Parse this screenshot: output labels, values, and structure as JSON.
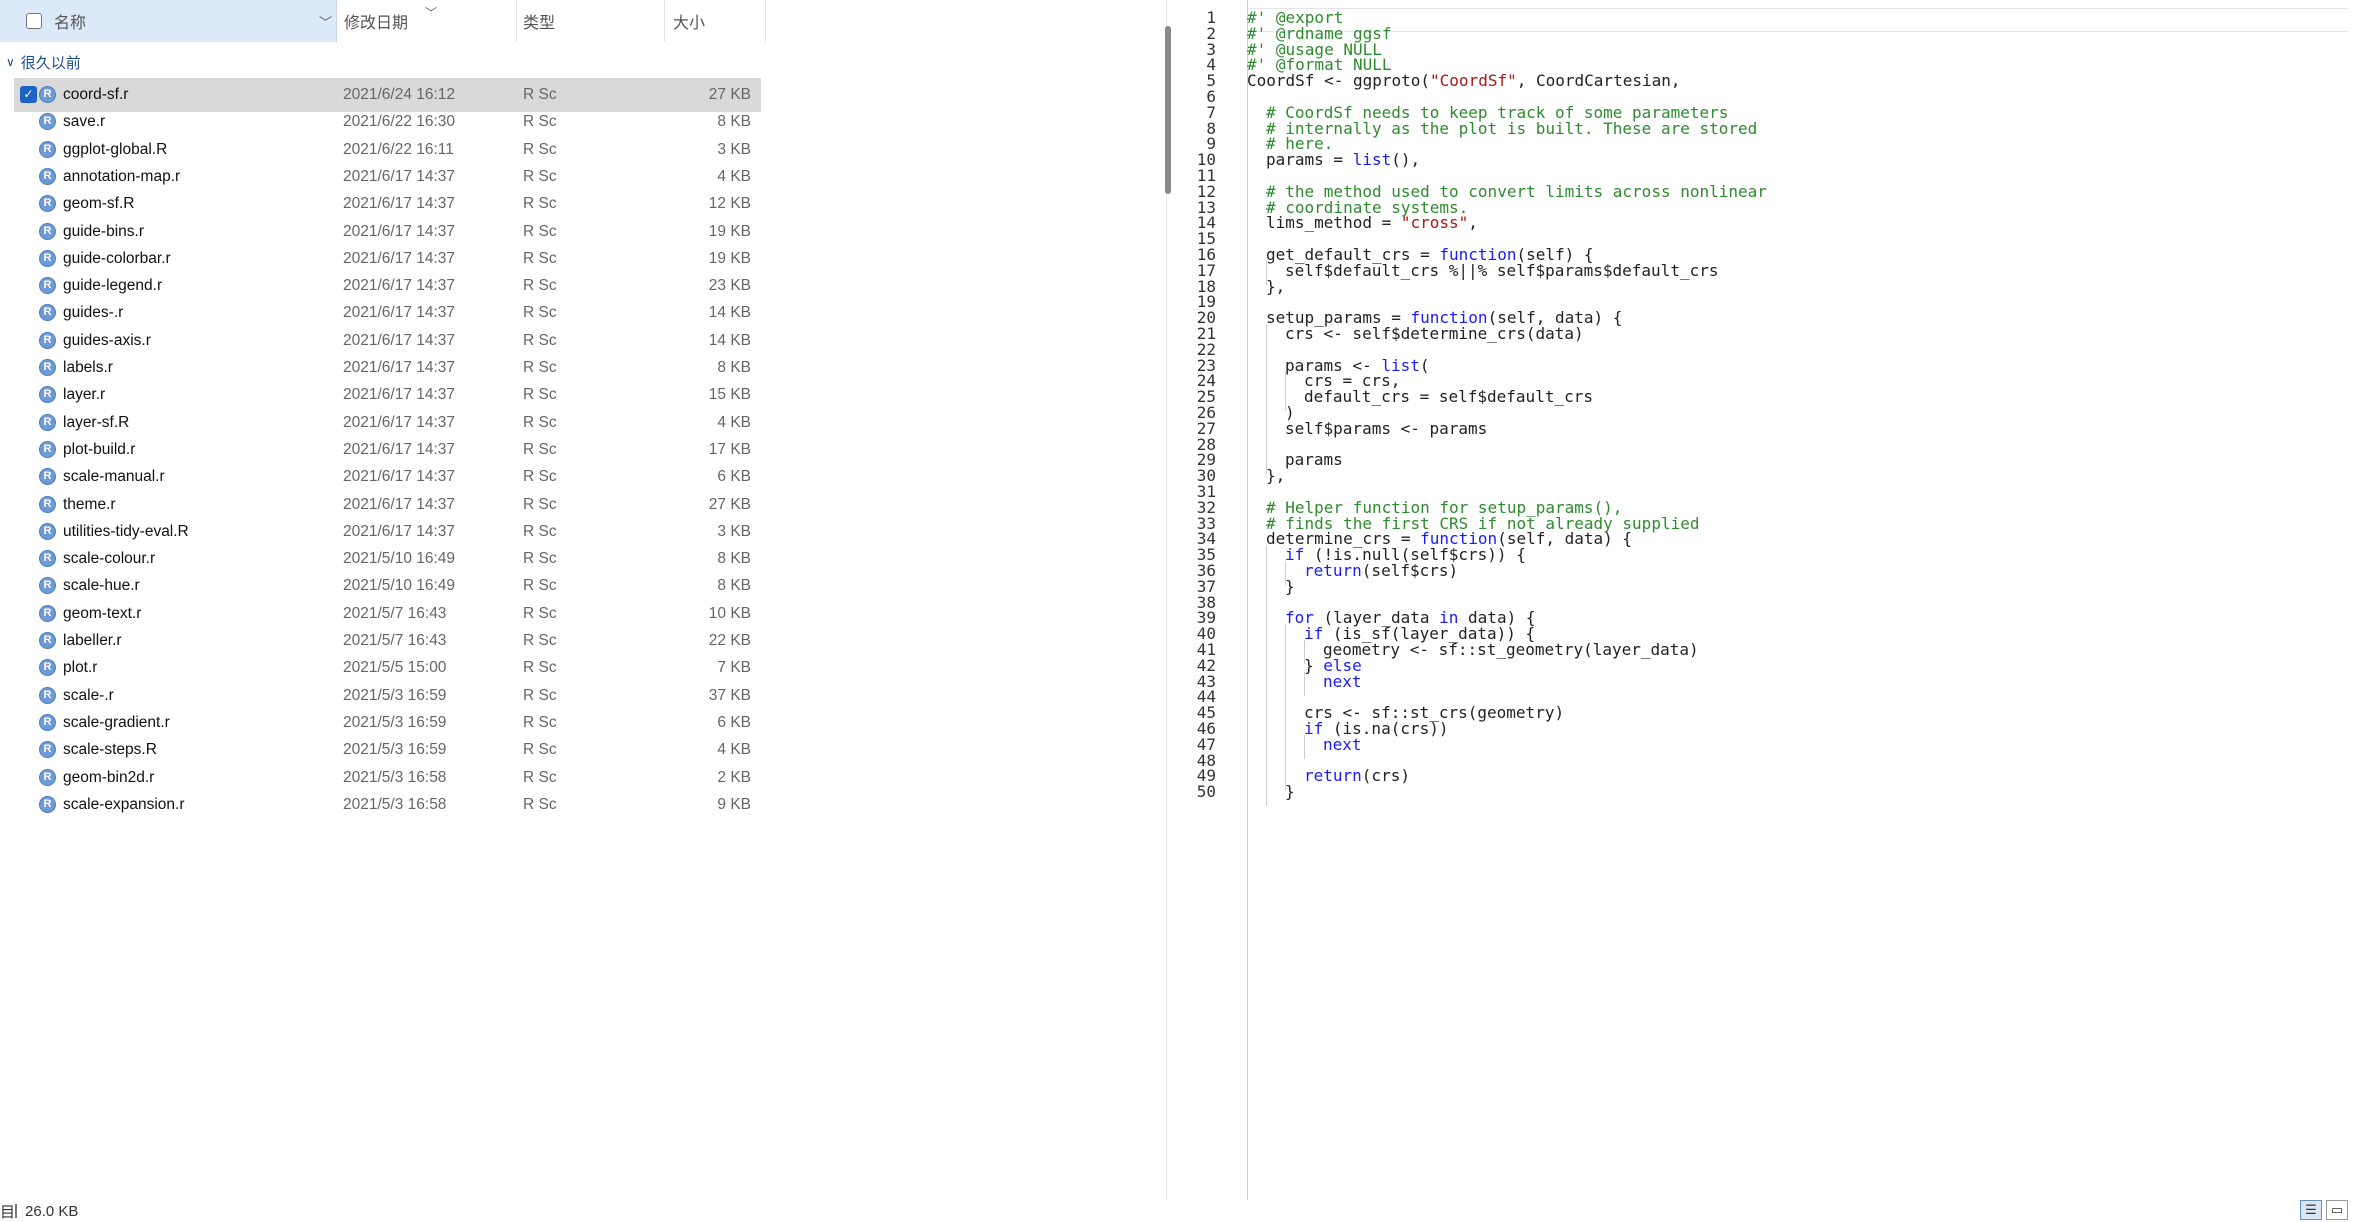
{
  "explorer": {
    "columns": {
      "name": "名称",
      "date": "修改日期",
      "type": "类型",
      "size": "大小"
    },
    "group_label": "很久以前",
    "files": [
      {
        "name": "coord-sf.r",
        "date": "2021/6/24 16:12",
        "type": "R Sc",
        "size": "27 KB",
        "selected": true
      },
      {
        "name": "save.r",
        "date": "2021/6/22 16:30",
        "type": "R Sc",
        "size": "8 KB"
      },
      {
        "name": "ggplot-global.R",
        "date": "2021/6/22 16:11",
        "type": "R Sc",
        "size": "3 KB"
      },
      {
        "name": "annotation-map.r",
        "date": "2021/6/17 14:37",
        "type": "R Sc",
        "size": "4 KB"
      },
      {
        "name": "geom-sf.R",
        "date": "2021/6/17 14:37",
        "type": "R Sc",
        "size": "12 KB"
      },
      {
        "name": "guide-bins.r",
        "date": "2021/6/17 14:37",
        "type": "R Sc",
        "size": "19 KB"
      },
      {
        "name": "guide-colorbar.r",
        "date": "2021/6/17 14:37",
        "type": "R Sc",
        "size": "19 KB"
      },
      {
        "name": "guide-legend.r",
        "date": "2021/6/17 14:37",
        "type": "R Sc",
        "size": "23 KB"
      },
      {
        "name": "guides-.r",
        "date": "2021/6/17 14:37",
        "type": "R Sc",
        "size": "14 KB"
      },
      {
        "name": "guides-axis.r",
        "date": "2021/6/17 14:37",
        "type": "R Sc",
        "size": "14 KB"
      },
      {
        "name": "labels.r",
        "date": "2021/6/17 14:37",
        "type": "R Sc",
        "size": "8 KB"
      },
      {
        "name": "layer.r",
        "date": "2021/6/17 14:37",
        "type": "R Sc",
        "size": "15 KB"
      },
      {
        "name": "layer-sf.R",
        "date": "2021/6/17 14:37",
        "type": "R Sc",
        "size": "4 KB"
      },
      {
        "name": "plot-build.r",
        "date": "2021/6/17 14:37",
        "type": "R Sc",
        "size": "17 KB"
      },
      {
        "name": "scale-manual.r",
        "date": "2021/6/17 14:37",
        "type": "R Sc",
        "size": "6 KB"
      },
      {
        "name": "theme.r",
        "date": "2021/6/17 14:37",
        "type": "R Sc",
        "size": "27 KB"
      },
      {
        "name": "utilities-tidy-eval.R",
        "date": "2021/6/17 14:37",
        "type": "R Sc",
        "size": "3 KB"
      },
      {
        "name": "scale-colour.r",
        "date": "2021/5/10 16:49",
        "type": "R Sc",
        "size": "8 KB"
      },
      {
        "name": "scale-hue.r",
        "date": "2021/5/10 16:49",
        "type": "R Sc",
        "size": "8 KB"
      },
      {
        "name": "geom-text.r",
        "date": "2021/5/7 16:43",
        "type": "R Sc",
        "size": "10 KB"
      },
      {
        "name": "labeller.r",
        "date": "2021/5/7 16:43",
        "type": "R Sc",
        "size": "22 KB"
      },
      {
        "name": "plot.r",
        "date": "2021/5/5 15:00",
        "type": "R Sc",
        "size": "7 KB"
      },
      {
        "name": "scale-.r",
        "date": "2021/5/3 16:59",
        "type": "R Sc",
        "size": "37 KB"
      },
      {
        "name": "scale-gradient.r",
        "date": "2021/5/3 16:59",
        "type": "R Sc",
        "size": "6 KB"
      },
      {
        "name": "scale-steps.R",
        "date": "2021/5/3 16:59",
        "type": "R Sc",
        "size": "4 KB"
      },
      {
        "name": "geom-bin2d.r",
        "date": "2021/5/3 16:58",
        "type": "R Sc",
        "size": "2 KB"
      },
      {
        "name": "scale-expansion.r",
        "date": "2021/5/3 16:58",
        "type": "R Sc",
        "size": "9 KB"
      }
    ],
    "status": {
      "prefix": "目",
      "selected_size": "26.0 KB"
    },
    "icons": {
      "file": "r-script-icon",
      "checkbox": "checkbox-icon",
      "chevron": "chevron-down-icon"
    }
  },
  "editor": {
    "lines": [
      [
        [
          "cm",
          "#' @export"
        ]
      ],
      [
        [
          "cm",
          "#' @rdname ggsf"
        ]
      ],
      [
        [
          "cm",
          "#' @usage NULL"
        ]
      ],
      [
        [
          "cm",
          "#' @format NULL"
        ]
      ],
      [
        [
          "tx",
          "CoordSf <- ggproto("
        ],
        [
          "st",
          "\"CoordSf\""
        ],
        [
          "tx",
          ", CoordCartesian,"
        ]
      ],
      [
        [
          "i1",
          ""
        ]
      ],
      [
        [
          "i1",
          ""
        ],
        [
          "cm",
          "# CoordSf needs to keep track of some parameters"
        ]
      ],
      [
        [
          "i1",
          ""
        ],
        [
          "cm",
          "# internally as the plot is built. These are stored"
        ]
      ],
      [
        [
          "i1",
          ""
        ],
        [
          "cm",
          "# here."
        ]
      ],
      [
        [
          "i1",
          ""
        ],
        [
          "tx",
          "params = "
        ],
        [
          "kw",
          "list"
        ],
        [
          "tx",
          "(),"
        ]
      ],
      [
        [
          "i1",
          ""
        ]
      ],
      [
        [
          "i1",
          ""
        ],
        [
          "cm",
          "# the method used to convert limits across nonlinear"
        ]
      ],
      [
        [
          "i1",
          ""
        ],
        [
          "cm",
          "# coordinate systems."
        ]
      ],
      [
        [
          "i1",
          ""
        ],
        [
          "tx",
          "lims_method = "
        ],
        [
          "st",
          "\"cross\""
        ],
        [
          "tx",
          ","
        ]
      ],
      [
        [
          "i1",
          ""
        ]
      ],
      [
        [
          "i1",
          ""
        ],
        [
          "tx",
          "get_default_crs = "
        ],
        [
          "kw",
          "function"
        ],
        [
          "tx",
          "(self) {"
        ]
      ],
      [
        [
          "i2",
          ""
        ],
        [
          "tx",
          "self$default_crs %||% self$params$default_crs"
        ]
      ],
      [
        [
          "i1",
          ""
        ],
        [
          "tx",
          "},"
        ]
      ],
      [
        [
          "i1",
          ""
        ]
      ],
      [
        [
          "i1",
          ""
        ],
        [
          "tx",
          "setup_params = "
        ],
        [
          "kw",
          "function"
        ],
        [
          "tx",
          "(self, data) {"
        ]
      ],
      [
        [
          "i2",
          ""
        ],
        [
          "tx",
          "crs <- self$determine_crs(data)"
        ]
      ],
      [
        [
          "i2",
          ""
        ]
      ],
      [
        [
          "i2",
          ""
        ],
        [
          "tx",
          "params <- "
        ],
        [
          "kw",
          "list"
        ],
        [
          "tx",
          "("
        ]
      ],
      [
        [
          "i3",
          ""
        ],
        [
          "tx",
          "crs = crs,"
        ]
      ],
      [
        [
          "i3",
          ""
        ],
        [
          "tx",
          "default_crs = self$default_crs"
        ]
      ],
      [
        [
          "i2",
          ""
        ],
        [
          "tx",
          ")"
        ]
      ],
      [
        [
          "i2",
          ""
        ],
        [
          "tx",
          "self$params <- params"
        ]
      ],
      [
        [
          "i2",
          ""
        ]
      ],
      [
        [
          "i2",
          ""
        ],
        [
          "tx",
          "params"
        ]
      ],
      [
        [
          "i1",
          ""
        ],
        [
          "tx",
          "},"
        ]
      ],
      [
        [
          "i1",
          ""
        ]
      ],
      [
        [
          "i1",
          ""
        ],
        [
          "cm",
          "# Helper function for setup_params(),"
        ]
      ],
      [
        [
          "i1",
          ""
        ],
        [
          "cm",
          "# finds the first CRS if not already supplied"
        ]
      ],
      [
        [
          "i1",
          ""
        ],
        [
          "tx",
          "determine_crs = "
        ],
        [
          "kw",
          "function"
        ],
        [
          "tx",
          "(self, data) {"
        ]
      ],
      [
        [
          "i2",
          ""
        ],
        [
          "kw",
          "if"
        ],
        [
          "tx",
          " (!is.null(self$crs)) {"
        ]
      ],
      [
        [
          "i3",
          ""
        ],
        [
          "kw",
          "return"
        ],
        [
          "tx",
          "(self$crs)"
        ]
      ],
      [
        [
          "i2",
          ""
        ],
        [
          "tx",
          "}"
        ]
      ],
      [
        [
          "i2",
          ""
        ]
      ],
      [
        [
          "i2",
          ""
        ],
        [
          "kw",
          "for"
        ],
        [
          "tx",
          " (layer_data "
        ],
        [
          "kw",
          "in"
        ],
        [
          "tx",
          " data) {"
        ]
      ],
      [
        [
          "i3",
          ""
        ],
        [
          "kw",
          "if"
        ],
        [
          "tx",
          " (is_sf(layer_data)) {"
        ]
      ],
      [
        [
          "i4",
          ""
        ],
        [
          "tx",
          "geometry <- sf::st_geometry(layer_data)"
        ]
      ],
      [
        [
          "i3",
          ""
        ],
        [
          "tx",
          "} "
        ],
        [
          "kw",
          "else"
        ]
      ],
      [
        [
          "i4",
          ""
        ],
        [
          "kw",
          "next"
        ]
      ],
      [
        [
          "i3",
          ""
        ]
      ],
      [
        [
          "i3",
          ""
        ],
        [
          "tx",
          "crs <- sf::st_crs(geometry)"
        ]
      ],
      [
        [
          "i3",
          ""
        ],
        [
          "kw",
          "if"
        ],
        [
          "tx",
          " (is.na(crs))"
        ]
      ],
      [
        [
          "i4",
          ""
        ],
        [
          "kw",
          "next"
        ]
      ],
      [
        [
          "i3",
          ""
        ]
      ],
      [
        [
          "i3",
          ""
        ],
        [
          "kw",
          "return"
        ],
        [
          "tx",
          "(crs)"
        ]
      ],
      [
        [
          "i2",
          ""
        ],
        [
          "tx",
          "}"
        ]
      ]
    ],
    "view_icons": [
      "details-view-icon",
      "preview-pane-icon"
    ]
  }
}
